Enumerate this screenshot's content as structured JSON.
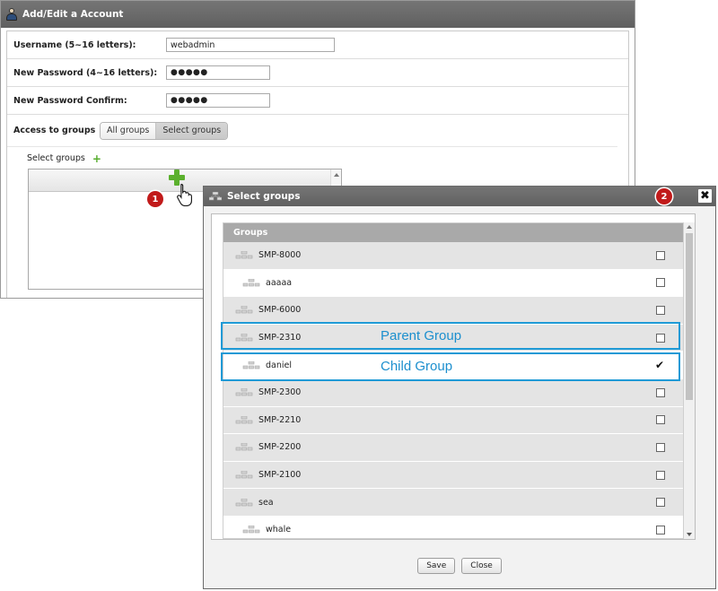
{
  "account_window": {
    "title": "Add/Edit a Account",
    "fields": [
      {
        "label": "Username (5~16 letters):",
        "value": "webadmin"
      },
      {
        "label": "New Password (4~16 letters):",
        "value": "●●●●●"
      },
      {
        "label": "New Password Confirm:",
        "value": "●●●●●"
      }
    ],
    "access": {
      "label": "Access to groups",
      "options": [
        "All groups",
        "Select groups"
      ],
      "selected": "Select groups"
    },
    "select_groups_label": "Select groups"
  },
  "callouts": {
    "step1": "1",
    "step2": "2",
    "parent_label": "Parent Group",
    "child_label": "Child Group",
    "highlight_color": "#1f9ad6"
  },
  "dialog": {
    "title": "Select groups",
    "close_glyph": "✖",
    "column_header": "Groups",
    "groups": [
      {
        "name": "SMP-8000",
        "level": "parent",
        "checked": false
      },
      {
        "name": "aaaaa",
        "level": "child",
        "checked": false
      },
      {
        "name": "SMP-6000",
        "level": "parent",
        "checked": false
      },
      {
        "name": "SMP-2310",
        "level": "parent",
        "checked": false
      },
      {
        "name": "daniel",
        "level": "child",
        "checked": true
      },
      {
        "name": "SMP-2300",
        "level": "parent",
        "checked": false
      },
      {
        "name": "SMP-2210",
        "level": "parent",
        "checked": false
      },
      {
        "name": "SMP-2200",
        "level": "parent",
        "checked": false
      },
      {
        "name": "SMP-2100",
        "level": "parent",
        "checked": false
      },
      {
        "name": "sea",
        "level": "parent",
        "checked": false
      },
      {
        "name": "whale",
        "level": "child",
        "checked": false
      }
    ],
    "save_label": "Save",
    "close_label": "Close"
  },
  "icons": {
    "title_icon": "user-icon",
    "add_icon": "plus-icon",
    "cursor": "hand-pointer-icon",
    "group_icon": "group-tree-icon"
  }
}
